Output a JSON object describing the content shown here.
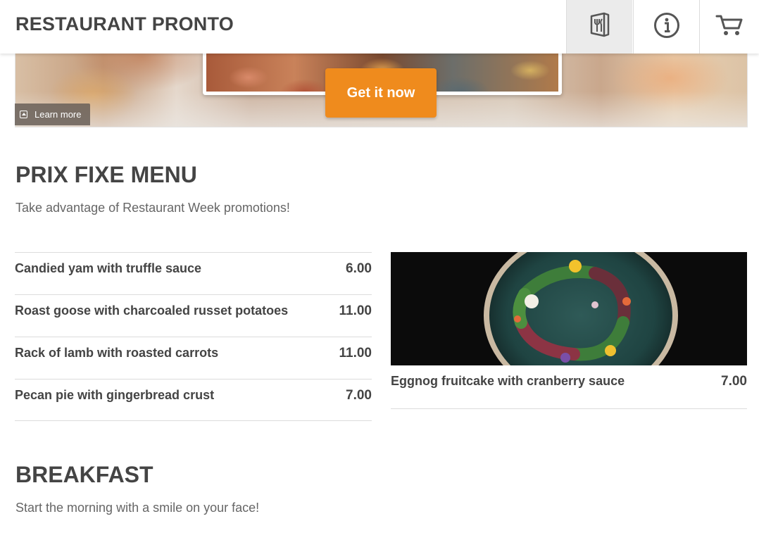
{
  "header": {
    "brand": "RESTAURANT PRONTO",
    "nav": [
      {
        "icon": "menu-utensils-icon",
        "active": true
      },
      {
        "icon": "info-icon",
        "active": false
      },
      {
        "icon": "cart-icon",
        "active": false
      }
    ]
  },
  "hero": {
    "cta_label": "Get it now",
    "learn_more_label": "Learn more"
  },
  "prix_fixe": {
    "title": "PRIX FIXE MENU",
    "subtitle": "Take advantage of Restaurant Week promotions!",
    "items": [
      {
        "name": "Candied yam with truffle sauce",
        "price": "6.00"
      },
      {
        "name": "Roast goose with charcoaled russet potatoes",
        "price": "11.00"
      },
      {
        "name": "Rack of lamb with roasted carrots",
        "price": "11.00"
      },
      {
        "name": "Pecan pie with gingerbread crust",
        "price": "7.00"
      }
    ],
    "featured": {
      "name": "Eggnog fruitcake with cranberry sauce",
      "price": "7.00"
    }
  },
  "breakfast": {
    "title": "BREAKFAST",
    "subtitle": "Start the morning with a smile on your face!"
  },
  "colors": {
    "accent": "#ef8b1d",
    "text": "#444444",
    "divider": "#dcdcdc",
    "active_nav": "#ebebeb"
  }
}
